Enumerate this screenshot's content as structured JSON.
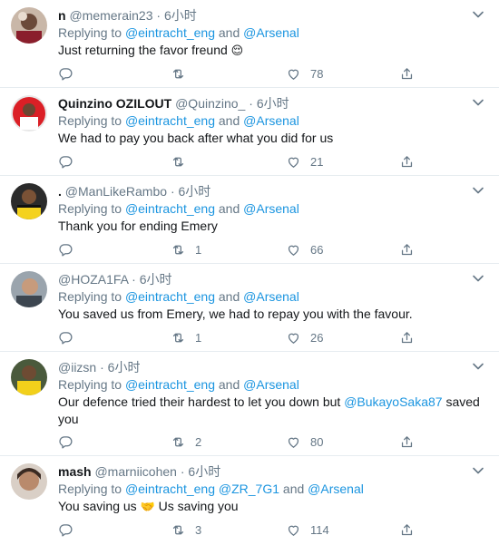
{
  "reply_to_label": "Replying to",
  "and_label": "and",
  "tweets": [
    {
      "name": "n",
      "handle": "@memerain23",
      "dot": "·",
      "time": "6小时",
      "mentions": [
        "@eintracht_eng",
        "@Arsenal"
      ],
      "text": "Just returning the favor freund",
      "emoji": "😌",
      "retweets": "",
      "likes": "78"
    },
    {
      "name": "Quinzino OZILOUT",
      "handle": "@Quinzino_",
      "dot": "·",
      "time": "6小时",
      "mentions": [
        "@eintracht_eng",
        "@Arsenal"
      ],
      "text": "We had to pay you back after what you did for us",
      "retweets": "",
      "likes": "21"
    },
    {
      "name": ".",
      "handle": "@ManLikeRambo",
      "dot": "·",
      "time": "6小时",
      "mentions": [
        "@eintracht_eng",
        "@Arsenal"
      ],
      "text": "Thank you for ending Emery",
      "retweets": "1",
      "likes": "66"
    },
    {
      "name": "",
      "handle": "@HOZA1FA",
      "dot": "·",
      "time": "6小时",
      "mentions": [
        "@eintracht_eng",
        "@Arsenal"
      ],
      "text": "You saved us from Emery, we had to repay you with the favour.",
      "retweets": "1",
      "likes": "26"
    },
    {
      "name": "",
      "handle": "@iizsn",
      "dot": "·",
      "time": "6小时",
      "mentions": [
        "@eintracht_eng",
        "@Arsenal"
      ],
      "text_before": "Our defence tried their hardest to let you down but",
      "text_mention": "@BukayoSaka87",
      "text_after": "saved",
      "text_line2": "you",
      "retweets": "2",
      "likes": "80"
    },
    {
      "name": "mash",
      "handle": "@marniicohen",
      "dot": "·",
      "time": "6小时",
      "mentions": [
        "@eintracht_eng",
        "@ZR_7G1",
        "@Arsenal"
      ],
      "text": "You saving us",
      "emoji": "🤝",
      "text_after": "Us saving you",
      "retweets": "3",
      "likes": "114"
    }
  ],
  "icons": {
    "reply": "reply-icon",
    "retweet": "retweet-icon",
    "like": "heart-icon",
    "share": "share-icon",
    "caret": "chevron-down-icon"
  },
  "colors": {
    "link": "#1b95e0",
    "muted": "#657786",
    "text": "#14171a",
    "divider": "#e6ecf0"
  }
}
